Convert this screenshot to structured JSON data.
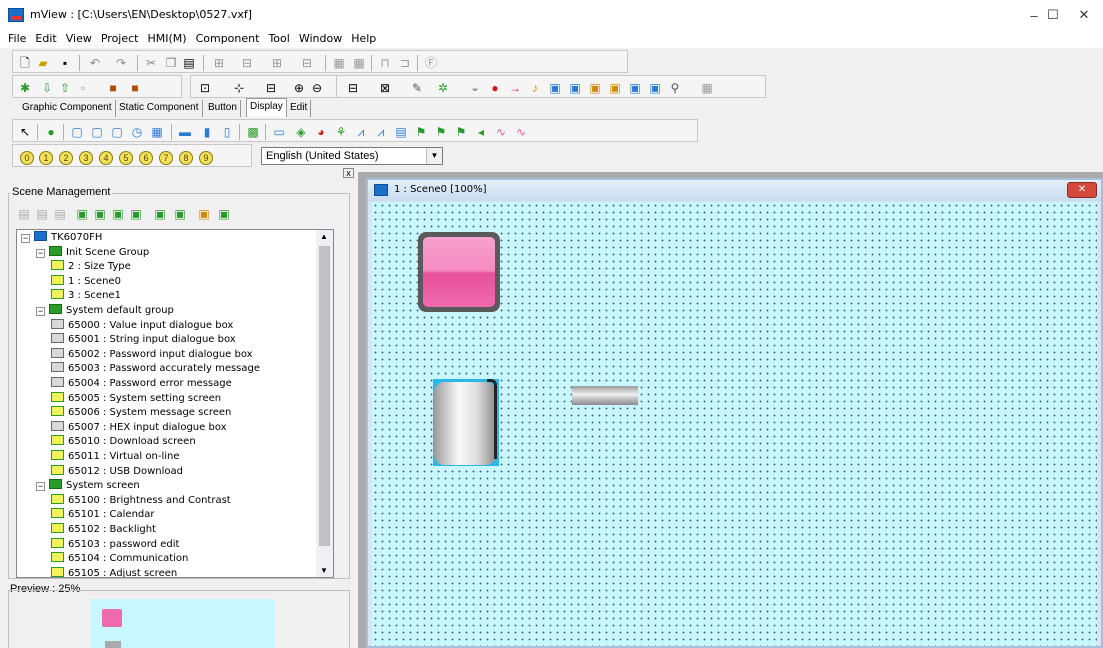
{
  "window": {
    "title": "mView : [C:\\Users\\EN\\Desktop\\0527.vxf]",
    "minimize_glyph": "–",
    "maximize_glyph": "☐",
    "close_glyph": "✕"
  },
  "menu": [
    "File",
    "Edit",
    "View",
    "Project",
    "HMI(M)",
    "Component",
    "Tool",
    "Window",
    "Help"
  ],
  "tabs": [
    "Graphic Component",
    "Static Component",
    "Button",
    "Display",
    "Edit"
  ],
  "active_tab": "Display",
  "number_buttons": [
    "0",
    "1",
    "2",
    "3",
    "4",
    "5",
    "6",
    "7",
    "8",
    "9"
  ],
  "language": "English (United States)",
  "scene_panel": {
    "title": "Scene Management",
    "tree": [
      {
        "label": "TK6070FH",
        "level": 0,
        "icon": "root-icon",
        "expander": "−"
      },
      {
        "label": "Init Scene Group",
        "level": 1,
        "icon": "group-icon",
        "expander": "−"
      },
      {
        "label": "2 : Size Type",
        "level": 2,
        "icon": "scene-icon"
      },
      {
        "label": "1 : Scene0",
        "level": 2,
        "icon": "scene-icon"
      },
      {
        "label": "3 : Scene1",
        "level": 2,
        "icon": "scene-icon"
      },
      {
        "label": "System default group",
        "level": 1,
        "icon": "group-icon",
        "expander": "−"
      },
      {
        "label": "65000 : Value input dialogue box",
        "level": 2,
        "icon": "dialog-icon"
      },
      {
        "label": "65001 : String input dialogue box",
        "level": 2,
        "icon": "dialog-icon"
      },
      {
        "label": "65002 : Password input dialogue box",
        "level": 2,
        "icon": "dialog-icon"
      },
      {
        "label": "65003 : Password accurately message",
        "level": 2,
        "icon": "dialog-icon"
      },
      {
        "label": "65004 : Password error message",
        "level": 2,
        "icon": "dialog-icon"
      },
      {
        "label": "65005 : System setting screen",
        "level": 2,
        "icon": "scene-icon"
      },
      {
        "label": "65006 : System message screen",
        "level": 2,
        "icon": "scene-icon"
      },
      {
        "label": "65007 : HEX input dialogue box",
        "level": 2,
        "icon": "dialog-icon"
      },
      {
        "label": "65010 : Download screen",
        "level": 2,
        "icon": "scene-icon"
      },
      {
        "label": "65011 : Virtual on-line",
        "level": 2,
        "icon": "scene-icon"
      },
      {
        "label": "65012 : USB Download",
        "level": 2,
        "icon": "scene-icon"
      },
      {
        "label": "System screen",
        "level": 1,
        "icon": "group-icon",
        "expander": "−"
      },
      {
        "label": "65100 : Brightness and Contrast",
        "level": 2,
        "icon": "scene-icon"
      },
      {
        "label": "65101 : Calendar",
        "level": 2,
        "icon": "scene-icon"
      },
      {
        "label": "65102 : Backlight",
        "level": 2,
        "icon": "scene-icon"
      },
      {
        "label": "65103 : password edit",
        "level": 2,
        "icon": "scene-icon"
      },
      {
        "label": "65104 : Communication",
        "level": 2,
        "icon": "scene-icon"
      },
      {
        "label": "65105 : Adjust screen",
        "level": 2,
        "icon": "scene-icon"
      }
    ]
  },
  "preview": {
    "label": "Preview : 25%"
  },
  "child_window": {
    "title": "1 : Scene0 [100%]",
    "close_glyph": "✕"
  },
  "panel_close_glyph": "x",
  "colors": {
    "canvas_bg": "#c8f7ff",
    "pink_button": "#ef6aae",
    "tank_bg": "#29b8e8"
  }
}
